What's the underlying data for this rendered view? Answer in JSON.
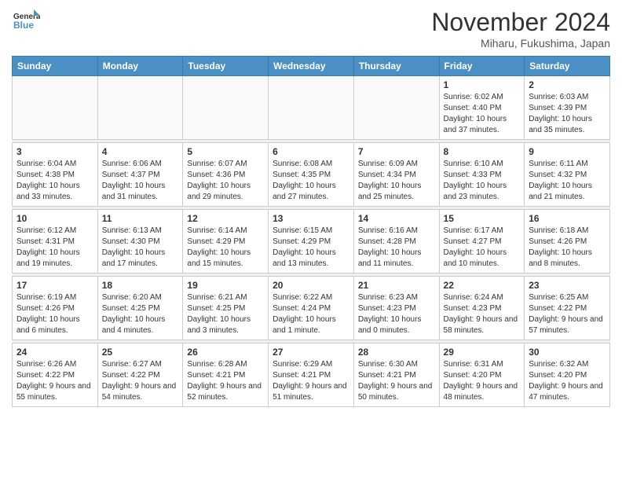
{
  "logo": {
    "line1": "General",
    "line2": "Blue"
  },
  "title": "November 2024",
  "location": "Miharu, Fukushima, Japan",
  "weekdays": [
    "Sunday",
    "Monday",
    "Tuesday",
    "Wednesday",
    "Thursday",
    "Friday",
    "Saturday"
  ],
  "weeks": [
    [
      {
        "day": "",
        "info": ""
      },
      {
        "day": "",
        "info": ""
      },
      {
        "day": "",
        "info": ""
      },
      {
        "day": "",
        "info": ""
      },
      {
        "day": "",
        "info": ""
      },
      {
        "day": "1",
        "info": "Sunrise: 6:02 AM\nSunset: 4:40 PM\nDaylight: 10 hours and 37 minutes."
      },
      {
        "day": "2",
        "info": "Sunrise: 6:03 AM\nSunset: 4:39 PM\nDaylight: 10 hours and 35 minutes."
      }
    ],
    [
      {
        "day": "3",
        "info": "Sunrise: 6:04 AM\nSunset: 4:38 PM\nDaylight: 10 hours and 33 minutes."
      },
      {
        "day": "4",
        "info": "Sunrise: 6:06 AM\nSunset: 4:37 PM\nDaylight: 10 hours and 31 minutes."
      },
      {
        "day": "5",
        "info": "Sunrise: 6:07 AM\nSunset: 4:36 PM\nDaylight: 10 hours and 29 minutes."
      },
      {
        "day": "6",
        "info": "Sunrise: 6:08 AM\nSunset: 4:35 PM\nDaylight: 10 hours and 27 minutes."
      },
      {
        "day": "7",
        "info": "Sunrise: 6:09 AM\nSunset: 4:34 PM\nDaylight: 10 hours and 25 minutes."
      },
      {
        "day": "8",
        "info": "Sunrise: 6:10 AM\nSunset: 4:33 PM\nDaylight: 10 hours and 23 minutes."
      },
      {
        "day": "9",
        "info": "Sunrise: 6:11 AM\nSunset: 4:32 PM\nDaylight: 10 hours and 21 minutes."
      }
    ],
    [
      {
        "day": "10",
        "info": "Sunrise: 6:12 AM\nSunset: 4:31 PM\nDaylight: 10 hours and 19 minutes."
      },
      {
        "day": "11",
        "info": "Sunrise: 6:13 AM\nSunset: 4:30 PM\nDaylight: 10 hours and 17 minutes."
      },
      {
        "day": "12",
        "info": "Sunrise: 6:14 AM\nSunset: 4:29 PM\nDaylight: 10 hours and 15 minutes."
      },
      {
        "day": "13",
        "info": "Sunrise: 6:15 AM\nSunset: 4:29 PM\nDaylight: 10 hours and 13 minutes."
      },
      {
        "day": "14",
        "info": "Sunrise: 6:16 AM\nSunset: 4:28 PM\nDaylight: 10 hours and 11 minutes."
      },
      {
        "day": "15",
        "info": "Sunrise: 6:17 AM\nSunset: 4:27 PM\nDaylight: 10 hours and 10 minutes."
      },
      {
        "day": "16",
        "info": "Sunrise: 6:18 AM\nSunset: 4:26 PM\nDaylight: 10 hours and 8 minutes."
      }
    ],
    [
      {
        "day": "17",
        "info": "Sunrise: 6:19 AM\nSunset: 4:26 PM\nDaylight: 10 hours and 6 minutes."
      },
      {
        "day": "18",
        "info": "Sunrise: 6:20 AM\nSunset: 4:25 PM\nDaylight: 10 hours and 4 minutes."
      },
      {
        "day": "19",
        "info": "Sunrise: 6:21 AM\nSunset: 4:25 PM\nDaylight: 10 hours and 3 minutes."
      },
      {
        "day": "20",
        "info": "Sunrise: 6:22 AM\nSunset: 4:24 PM\nDaylight: 10 hours and 1 minute."
      },
      {
        "day": "21",
        "info": "Sunrise: 6:23 AM\nSunset: 4:23 PM\nDaylight: 10 hours and 0 minutes."
      },
      {
        "day": "22",
        "info": "Sunrise: 6:24 AM\nSunset: 4:23 PM\nDaylight: 9 hours and 58 minutes."
      },
      {
        "day": "23",
        "info": "Sunrise: 6:25 AM\nSunset: 4:22 PM\nDaylight: 9 hours and 57 minutes."
      }
    ],
    [
      {
        "day": "24",
        "info": "Sunrise: 6:26 AM\nSunset: 4:22 PM\nDaylight: 9 hours and 55 minutes."
      },
      {
        "day": "25",
        "info": "Sunrise: 6:27 AM\nSunset: 4:22 PM\nDaylight: 9 hours and 54 minutes."
      },
      {
        "day": "26",
        "info": "Sunrise: 6:28 AM\nSunset: 4:21 PM\nDaylight: 9 hours and 52 minutes."
      },
      {
        "day": "27",
        "info": "Sunrise: 6:29 AM\nSunset: 4:21 PM\nDaylight: 9 hours and 51 minutes."
      },
      {
        "day": "28",
        "info": "Sunrise: 6:30 AM\nSunset: 4:21 PM\nDaylight: 9 hours and 50 minutes."
      },
      {
        "day": "29",
        "info": "Sunrise: 6:31 AM\nSunset: 4:20 PM\nDaylight: 9 hours and 48 minutes."
      },
      {
        "day": "30",
        "info": "Sunrise: 6:32 AM\nSunset: 4:20 PM\nDaylight: 9 hours and 47 minutes."
      }
    ]
  ]
}
